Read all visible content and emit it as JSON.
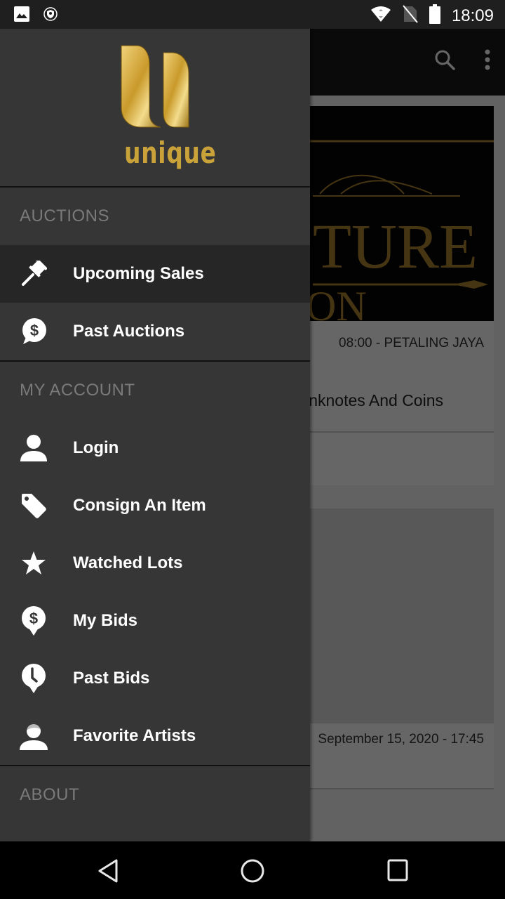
{
  "status_bar": {
    "time": "18:09",
    "left_icons": [
      "image-notification-icon",
      "vpn-shield-icon"
    ],
    "right_icons": [
      "wifi-icon",
      "no-sim-icon",
      "battery-icon"
    ]
  },
  "toolbar": {
    "actions": [
      "search-icon",
      "more-options-icon"
    ]
  },
  "background_content": {
    "cards": [
      {
        "banner_text_fragments": [
          "TURE",
          "ON"
        ],
        "meta": "08:00 - PETALING JAYA",
        "title_fragment": "nknotes And Coins"
      },
      {
        "meta": "September 15, 2020 - 17:45"
      }
    ]
  },
  "drawer": {
    "brand": "unique",
    "sections": [
      {
        "header": "AUCTIONS",
        "items": [
          {
            "label": "Upcoming Sales",
            "icon": "gavel-icon",
            "active": true
          },
          {
            "label": "Past Auctions",
            "icon": "dollar-chat-icon",
            "active": false
          }
        ]
      },
      {
        "header": "MY ACCOUNT",
        "items": [
          {
            "label": "Login",
            "icon": "person-icon",
            "active": false
          },
          {
            "label": "Consign An Item",
            "icon": "tag-icon",
            "active": false
          },
          {
            "label": "Watched Lots",
            "icon": "star-icon",
            "active": false
          },
          {
            "label": "My Bids",
            "icon": "dollar-pin-icon",
            "active": false
          },
          {
            "label": "Past Bids",
            "icon": "clock-pin-icon",
            "active": false
          },
          {
            "label": "Favorite Artists",
            "icon": "artist-icon",
            "active": false
          }
        ]
      },
      {
        "header": "ABOUT",
        "items": []
      }
    ]
  },
  "nav_bar": {
    "buttons": [
      "back-icon",
      "home-icon",
      "recents-icon"
    ]
  }
}
